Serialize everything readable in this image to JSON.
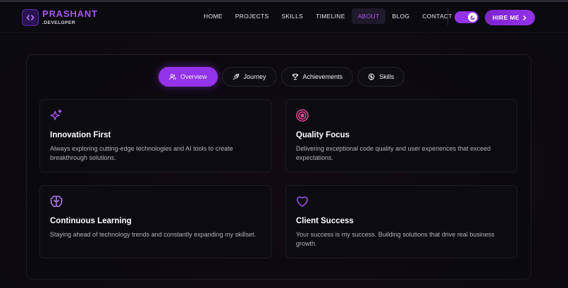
{
  "header": {
    "brand_name": "PRASHANT",
    "brand_sub": ".DEVELOPER",
    "nav": [
      {
        "label": "HOME"
      },
      {
        "label": "PROJECTS"
      },
      {
        "label": "SKILLS"
      },
      {
        "label": "TIMELINE"
      },
      {
        "label": "ABOUT",
        "active": true
      },
      {
        "label": "BLOG"
      },
      {
        "label": "CONTACT"
      }
    ],
    "hire_label": "HIRE ME",
    "hire_icon": "chevron-right-icon",
    "theme_toggle_icon": "moon-icon"
  },
  "tabs": [
    {
      "label": "Overview",
      "icon": "users-icon",
      "active": true
    },
    {
      "label": "Journey",
      "icon": "rocket-icon"
    },
    {
      "label": "Achievements",
      "icon": "trophy-icon"
    },
    {
      "label": "Skills",
      "icon": "brain-icon"
    }
  ],
  "cards": [
    {
      "title": "Innovation First",
      "icon": "sparkles-icon",
      "desc": "Always exploring cutting-edge technologies and AI tools to create breakthrough solutions."
    },
    {
      "title": "Quality Focus",
      "icon": "target-icon",
      "desc": "Delivering exceptional code quality and user experiences that exceed expectations."
    },
    {
      "title": "Continuous Learning",
      "icon": "brain-icon",
      "desc": "Staying ahead of technology trends and constantly expanding my skillset."
    },
    {
      "title": "Client Success",
      "icon": "heart-icon",
      "desc": "Your success is my success. Building solutions that drive real business growth."
    }
  ],
  "colors": {
    "accent": "#9333ea",
    "accent_text": "#a855f7",
    "target_icon": "#ec4899"
  }
}
